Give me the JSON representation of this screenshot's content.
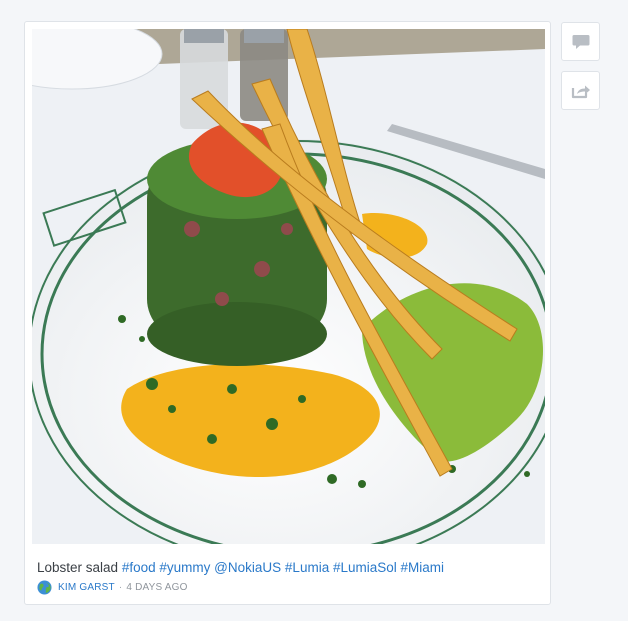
{
  "post": {
    "caption_text": "Lobster salad",
    "hashtags": [
      "#food",
      "#yummy",
      "@NokiaUS",
      "#Lumia",
      "#LumiaSol",
      "#Miami"
    ],
    "author": "KIM GARST",
    "separator": "·",
    "time": "4 DAYS AGO"
  },
  "sidebar": {
    "buttons": [
      {
        "icon": "comment-icon"
      },
      {
        "icon": "share-icon"
      }
    ]
  },
  "colors": {
    "link": "#2a79c9",
    "page_background": "#f4f6f9",
    "card_border": "#dfe3e8"
  }
}
